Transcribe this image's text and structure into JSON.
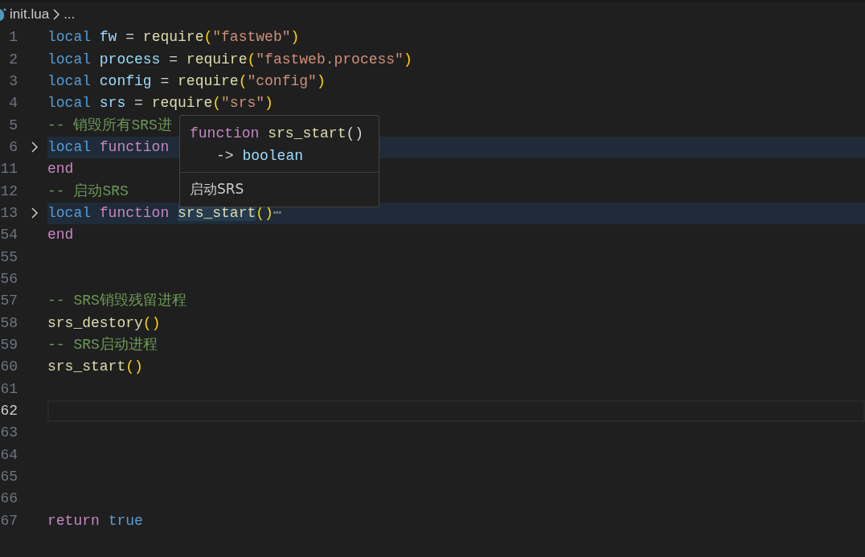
{
  "breadcrumb": {
    "file": "init.lua",
    "more": "..."
  },
  "lines": [
    {
      "number": "1",
      "folded": false,
      "current": false,
      "tokens": [
        {
          "text": "local ",
          "kind": "keyword"
        },
        {
          "text": "fw",
          "kind": "variable"
        },
        {
          "text": " = ",
          "kind": "plain"
        },
        {
          "text": "require",
          "kind": "function"
        },
        {
          "text": "(",
          "kind": "bracket"
        },
        {
          "text": "\"fastweb\"",
          "kind": "string"
        },
        {
          "text": ")",
          "kind": "bracket"
        }
      ]
    },
    {
      "number": "2",
      "folded": false,
      "current": false,
      "tokens": [
        {
          "text": "local ",
          "kind": "keyword"
        },
        {
          "text": "process",
          "kind": "variable"
        },
        {
          "text": " = ",
          "kind": "plain"
        },
        {
          "text": "require",
          "kind": "function"
        },
        {
          "text": "(",
          "kind": "bracket"
        },
        {
          "text": "\"fastweb.process\"",
          "kind": "string"
        },
        {
          "text": ")",
          "kind": "bracket"
        }
      ]
    },
    {
      "number": "3",
      "folded": false,
      "current": false,
      "tokens": [
        {
          "text": "local ",
          "kind": "keyword"
        },
        {
          "text": "config",
          "kind": "variable"
        },
        {
          "text": " = ",
          "kind": "plain"
        },
        {
          "text": "require",
          "kind": "function"
        },
        {
          "text": "(",
          "kind": "bracket"
        },
        {
          "text": "\"config\"",
          "kind": "string"
        },
        {
          "text": ")",
          "kind": "bracket"
        }
      ]
    },
    {
      "number": "4",
      "folded": false,
      "current": false,
      "tokens": [
        {
          "text": "local ",
          "kind": "keyword"
        },
        {
          "text": "srs",
          "kind": "variable"
        },
        {
          "text": " = ",
          "kind": "plain"
        },
        {
          "text": "require",
          "kind": "function"
        },
        {
          "text": "(",
          "kind": "bracket"
        },
        {
          "text": "\"srs\"",
          "kind": "string"
        },
        {
          "text": ")",
          "kind": "bracket"
        }
      ]
    },
    {
      "number": "5",
      "folded": false,
      "current": false,
      "tokens": [
        {
          "text": "-- 销毁所有SRS进",
          "kind": "comment"
        }
      ]
    },
    {
      "number": "6",
      "folded": true,
      "current": false,
      "tokens": [
        {
          "text": "local ",
          "kind": "keyword"
        },
        {
          "text": "function",
          "kind": "control"
        }
      ]
    },
    {
      "number": "11",
      "folded": false,
      "current": false,
      "tokens": [
        {
          "text": "end",
          "kind": "control"
        }
      ]
    },
    {
      "number": "12",
      "folded": false,
      "current": false,
      "tokens": [
        {
          "text": "-- 启动SRS",
          "kind": "comment"
        }
      ]
    },
    {
      "number": "13",
      "folded": true,
      "current": false,
      "tokens": [
        {
          "text": "local ",
          "kind": "keyword"
        },
        {
          "text": "function ",
          "kind": "control"
        },
        {
          "text": "srs_start",
          "kind": "hovered"
        },
        {
          "text": "()",
          "kind": "bracket"
        },
        {
          "text": "⋯",
          "kind": "ellipsis"
        }
      ]
    },
    {
      "number": "54",
      "folded": false,
      "current": false,
      "tokens": [
        {
          "text": "end",
          "kind": "control"
        }
      ]
    },
    {
      "number": "55",
      "folded": false,
      "current": false
    },
    {
      "number": "56",
      "folded": false,
      "current": false
    },
    {
      "number": "57",
      "folded": false,
      "current": false,
      "tokens": [
        {
          "text": "-- SRS销毁残留进程",
          "kind": "comment"
        }
      ]
    },
    {
      "number": "58",
      "folded": false,
      "current": false,
      "tokens": [
        {
          "text": "srs_destory",
          "kind": "function"
        },
        {
          "text": "()",
          "kind": "bracket"
        }
      ]
    },
    {
      "number": "59",
      "folded": false,
      "current": false,
      "tokens": [
        {
          "text": "-- SRS启动进程",
          "kind": "comment"
        }
      ]
    },
    {
      "number": "60",
      "folded": false,
      "current": false,
      "tokens": [
        {
          "text": "srs_start",
          "kind": "function"
        },
        {
          "text": "()",
          "kind": "bracket"
        }
      ]
    },
    {
      "number": "61",
      "folded": false,
      "current": false
    },
    {
      "number": "62",
      "folded": false,
      "current": true
    },
    {
      "number": "63",
      "folded": false,
      "current": false
    },
    {
      "number": "64",
      "folded": false,
      "current": false
    },
    {
      "number": "65",
      "folded": false,
      "current": false
    },
    {
      "number": "66",
      "folded": false,
      "current": false
    },
    {
      "number": "67",
      "folded": false,
      "current": false,
      "tokens": [
        {
          "text": "return ",
          "kind": "control"
        },
        {
          "text": "true",
          "kind": "keyword"
        }
      ]
    }
  ],
  "hover": {
    "signature": [
      {
        "text": "function ",
        "kind": "control"
      },
      {
        "text": "srs_start",
        "kind": "function"
      },
      {
        "text": "()",
        "kind": "plain"
      }
    ],
    "returns": [
      {
        "text": "-> ",
        "kind": "plain"
      },
      {
        "text": "boolean",
        "kind": "variable"
      }
    ],
    "doc": "启动SRS"
  }
}
